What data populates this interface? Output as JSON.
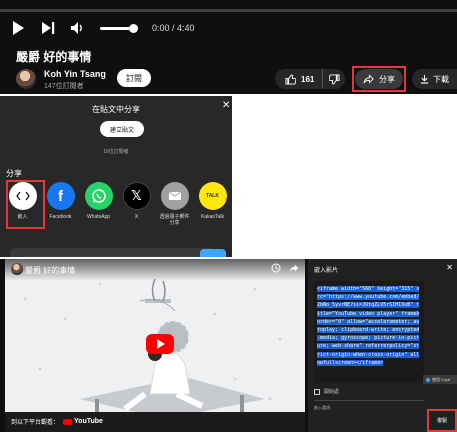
{
  "player": {
    "time": "0:00 / 4:40",
    "title": "嚴爵 好的事情",
    "channel": "Koh Yin Tsang",
    "subscribers": "147位訂閱者",
    "subscribe_label": "訂閱",
    "likes": "161",
    "share_label": "分享",
    "download_label": "下載"
  },
  "share_dialog": {
    "heading": "在貼文中分享",
    "create_post_label": "建立貼文",
    "subscribers": "16位訂閱者",
    "share_title": "分享",
    "targets": [
      {
        "label": "嵌入",
        "color": "#ffffff"
      },
      {
        "label": "Facebook",
        "color": "#1877f2"
      },
      {
        "label": "WhatsApp",
        "color": "#25d366"
      },
      {
        "label": "X",
        "color": "#000000"
      },
      {
        "label": "透過電子郵件分享",
        "color": "#a0a0a0"
      },
      {
        "label": "KakaoTalk",
        "color": "#ffe812"
      }
    ]
  },
  "embed_view": {
    "video_title": "嚴爵 好的事情",
    "watch_on": "到以下平台觀看：",
    "youtube": "YouTube",
    "panel_title": "嵌入影片",
    "code": "<iframe width=\"560\" height=\"315\" src=\"https://www.youtube.com/embed/2bNo_5yvrNE?si=JUtqZLV5rSIHIXxB\" title=\"YouTube video player\" frameborder=\"0\" allow=\"accelerometer; autoplay; clipboard-write; encrypted-media; gyroscope; picture-in-picture; web-share\" referrerpolicy=\"strict-origin-when-cross-origin\" allowfullscreen></iframe>",
    "copy_chip": "使用 Copil",
    "start_at": "開始處",
    "options": "嵌入選項",
    "copy_label": "複製"
  },
  "colors": {
    "accent_red": "#e53935",
    "yt_red": "#ff0000",
    "selection_blue": "#1f5fd1"
  }
}
